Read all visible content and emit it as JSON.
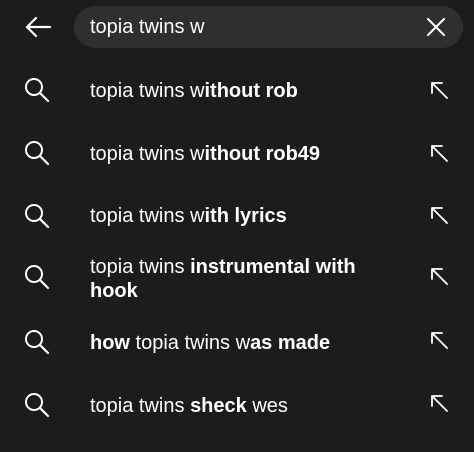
{
  "search": {
    "value": "topia twins w",
    "back_icon": "arrow-left-icon",
    "clear_icon": "close-icon"
  },
  "suggestions": [
    {
      "parts": [
        {
          "t": "topia twins w",
          "b": false
        },
        {
          "t": "ithout rob",
          "b": true
        }
      ]
    },
    {
      "parts": [
        {
          "t": "topia twins w",
          "b": false
        },
        {
          "t": "ithout rob49",
          "b": true
        }
      ]
    },
    {
      "parts": [
        {
          "t": "topia twins w",
          "b": false
        },
        {
          "t": "ith lyrics",
          "b": true
        }
      ]
    },
    {
      "parts": [
        {
          "t": "topia twins ",
          "b": false
        },
        {
          "t": "instrumental with hook",
          "b": true
        }
      ]
    },
    {
      "parts": [
        {
          "t": "how",
          "b": true
        },
        {
          "t": " topia twins w",
          "b": false
        },
        {
          "t": "as made",
          "b": true
        }
      ]
    },
    {
      "parts": [
        {
          "t": "topia twins ",
          "b": false
        },
        {
          "t": "sheck",
          "b": true
        },
        {
          "t": " wes",
          "b": false
        }
      ]
    }
  ],
  "icons": {
    "suggestion_icon": "search-icon",
    "fill_icon": "arrow-up-left-icon"
  },
  "colors": {
    "background": "#1c1c1c",
    "search_box": "#2f2f2f",
    "text": "#ffffff"
  }
}
